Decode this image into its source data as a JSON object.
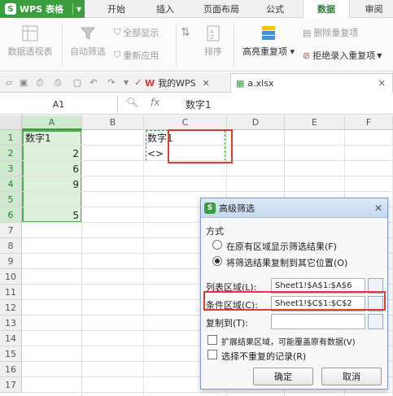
{
  "menubar": {
    "app_title": "WPS 表格",
    "tabs": [
      "开始",
      "插入",
      "页面布局",
      "公式",
      "数据",
      "审阅"
    ],
    "active_tab": "数据"
  },
  "ribbon": {
    "pivot": "数据透视表",
    "autofilter": "自动筛选",
    "show_all": "全部显示",
    "reapply": "重新应用",
    "sort": "排序",
    "highlight_dup": "高亮重复项",
    "remove_dup": "删除重复项",
    "reject_dup": "拒绝录入重复项"
  },
  "toolbar": {
    "wps_tab": "我的WPS",
    "file_tab": "a.xlsx"
  },
  "formulabar": {
    "cell_ref": "A1",
    "fx": "fx",
    "formula": "数字1"
  },
  "sheet": {
    "columns": [
      "A",
      "B",
      "C",
      "D",
      "E",
      "F"
    ],
    "rows": [
      "1",
      "2",
      "3",
      "4",
      "5",
      "6",
      "7",
      "8",
      "9",
      "10",
      "11",
      "12",
      "13",
      "14",
      "15",
      "16",
      "17"
    ],
    "cells": {
      "A1": "数字1",
      "A2": "2",
      "A3": "6",
      "A4": "9",
      "A6": "5",
      "C1": "数字1",
      "C2": "<>"
    }
  },
  "dialog": {
    "title": "高级筛选",
    "method_label": "方式",
    "option1": "在原有区域显示筛选结果(F)",
    "option2": "将筛选结果复制到其它位置(O)",
    "list_range_label": "列表区域(L):",
    "list_range_value": "Sheet1!$A$1:$A$6",
    "criteria_label": "条件区域(C):",
    "criteria_value": "Sheet1!$C$1:$C$2",
    "copy_to_label": "复制到(T):",
    "copy_to_value": "",
    "extend_label": "扩展结果区域，可能覆盖原有数据(V)",
    "unique_label": "选择不重复的记录(R)",
    "ok": "确定",
    "cancel": "取消"
  },
  "colors": {
    "accent": "#3c9d3e",
    "highlight": "#e53935"
  }
}
